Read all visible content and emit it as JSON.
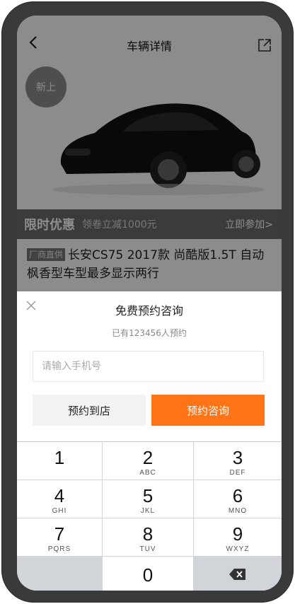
{
  "nav": {
    "title": "车辆详情"
  },
  "hero": {
    "badge": "新上"
  },
  "promo": {
    "title": "限时优惠",
    "desc": "领卷立减1000元",
    "action": "立即参加>"
  },
  "car": {
    "tag": "厂商直供",
    "title": "长安CS75 2017款 尚酷版1.5T 自动枫香型车型最多显示两行"
  },
  "modal": {
    "title": "免费预约咨询",
    "subtitle": "已有123456人预约",
    "phone_placeholder": "请输入手机号",
    "btn_store": "预约到店",
    "btn_consult": "预约咨询"
  },
  "keypad": {
    "keys": [
      {
        "num": "1",
        "letters": ""
      },
      {
        "num": "2",
        "letters": "ABC"
      },
      {
        "num": "3",
        "letters": "DEF"
      },
      {
        "num": "4",
        "letters": "GHI"
      },
      {
        "num": "5",
        "letters": "JKL"
      },
      {
        "num": "6",
        "letters": "MNO"
      },
      {
        "num": "7",
        "letters": "PQRS"
      },
      {
        "num": "8",
        "letters": "TUV"
      },
      {
        "num": "9",
        "letters": "WXYZ"
      },
      {
        "num": "0",
        "letters": ""
      }
    ]
  },
  "colors": {
    "accent": "#ff7416"
  }
}
